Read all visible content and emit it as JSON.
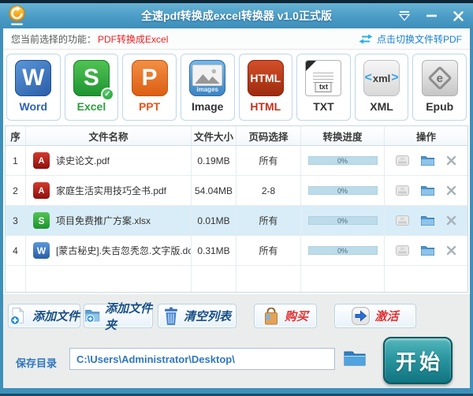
{
  "window": {
    "title": "全速pdf转换成excel转换器 v1.0正式版"
  },
  "function_bar": {
    "label": "您当前选择的功能：",
    "current": "PDF转换成Excel",
    "switch_label": "点击切换文件转PDF"
  },
  "formats": [
    {
      "id": "word",
      "label": "Word",
      "glyph": "W"
    },
    {
      "id": "excel",
      "label": "Excel",
      "glyph": "S",
      "selected": true,
      "check": "✓"
    },
    {
      "id": "ppt",
      "label": "PPT",
      "glyph": "P"
    },
    {
      "id": "image",
      "label": "Image",
      "glyph": "images"
    },
    {
      "id": "html",
      "label": "HTML",
      "glyph": "HTML"
    },
    {
      "id": "txt",
      "label": "TXT",
      "glyph": "txt"
    },
    {
      "id": "xml",
      "label": "XML",
      "glyph": "xml",
      "bracket_left": "<",
      "bracket_right": ">"
    },
    {
      "id": "epub",
      "label": "Epub",
      "glyph": "e"
    }
  ],
  "table": {
    "headers": [
      "序",
      "文件名称",
      "文件大小",
      "页码选择",
      "转换进度",
      "操作"
    ],
    "rows": [
      {
        "index": "1",
        "type": "pdf",
        "icon_glyph": "A",
        "name": "读史论文.pdf",
        "size": "0.19MB",
        "pages": "所有",
        "progress": "0%"
      },
      {
        "index": "2",
        "type": "pdf",
        "icon_glyph": "A",
        "name": "家庭生活实用技巧全书.pdf",
        "size": "54.04MB",
        "pages": "2-8",
        "progress": "0%"
      },
      {
        "index": "3",
        "type": "xlsx",
        "icon_glyph": "S",
        "name": "项目免费推广方案.xlsx",
        "size": "0.01MB",
        "pages": "所有",
        "progress": "0%",
        "selected": true
      },
      {
        "index": "4",
        "type": "doc",
        "icon_glyph": "W",
        "name": "[蒙古秘史].失吉忽秃忽.文字版.doc",
        "size": "0.31MB",
        "pages": "所有",
        "progress": "0%"
      }
    ]
  },
  "action_buttons": [
    {
      "label": "添加文件",
      "icon": "add-file-icon"
    },
    {
      "label": "添加文件夹",
      "icon": "add-folder-icon"
    },
    {
      "label": "清空列表",
      "icon": "trash-icon"
    },
    {
      "label": "购买",
      "icon": "shopping-bag-icon"
    },
    {
      "label": "激活",
      "icon": "activate-arrow-icon"
    }
  ],
  "save_bar": {
    "label": "保存目录",
    "path": "C:\\Users\\Administrator\\Desktop\\",
    "start": "开始"
  },
  "icons": {
    "logo": "orange-refresh-convert-circle",
    "skin": "chevron-down-menu",
    "minimize": "dash",
    "close": "x",
    "switch": "swap-arrows",
    "selected_badge": "check-circle",
    "op_open": "gray-tray",
    "op_folder": "blue-folder",
    "op_delete": "gray-x",
    "browse": "blue-folder"
  },
  "colors": {
    "titlebar": "#4a9cc6",
    "accent_red": "#ee2222",
    "link_blue": "#1b82d6",
    "row_highlight": "#d9edf8",
    "progress_track": "#bcdcea",
    "start_button": "#1d8a93",
    "button_text_blue": "#174f86",
    "button_text_red": "#e23333"
  }
}
